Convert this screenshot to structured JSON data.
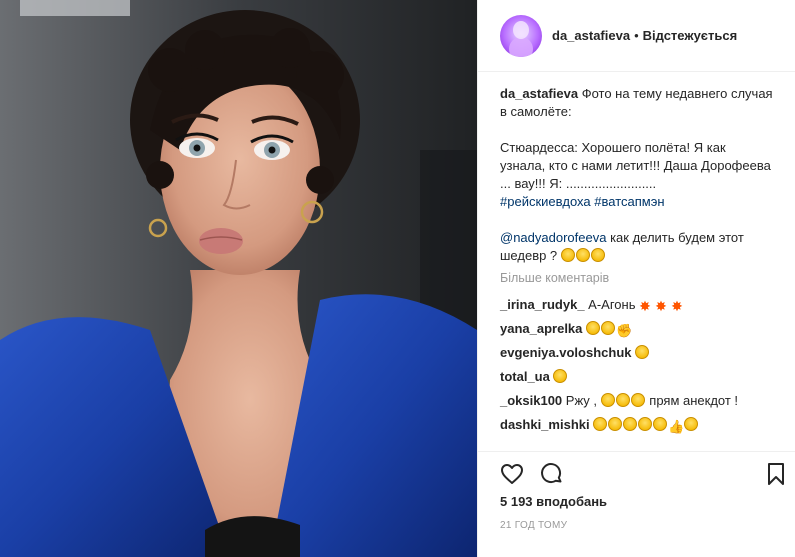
{
  "post": {
    "username": "da_astafieva",
    "separator": "•",
    "follow_label": "Відстежується",
    "caption_user": "da_astafieva",
    "caption_line1": "Фото на тему недавнего случая в самолёте:",
    "caption_line2": "Стюардесса: Хорошего полёта! Я как узнала, кто с нами летит!!! Даша Дорофеева ... вау!!! Я: .........................",
    "hashtags": "#рейскиевдоха #ватсапмэн",
    "mention": "@nadyadorofeeva",
    "mention_text": "как делить будем этот шедевр ?",
    "more_comments": "Більше коментарів",
    "likes": "5 193 вподобань",
    "time": "21 ГОД ТОМУ"
  },
  "comments": [
    {
      "user": "_irina_rudyk_",
      "text": "А-Агонь"
    },
    {
      "user": "yana_aprelka",
      "text": ""
    },
    {
      "user": "evgeniya.voloshchuk",
      "text": ""
    },
    {
      "user": "total_ua",
      "text": ""
    },
    {
      "user": "_oksik100",
      "text": "Ржу ,",
      "tail": "прям анекдот !"
    },
    {
      "user": "dashki_mishki",
      "text": ""
    }
  ],
  "icons": {
    "like": "heart-icon",
    "comment": "comment-icon",
    "save": "bookmark-icon"
  },
  "colors": {
    "text": "#262626",
    "muted": "#999999",
    "hashtag": "#003569",
    "blazer": "#1a3fa6"
  }
}
